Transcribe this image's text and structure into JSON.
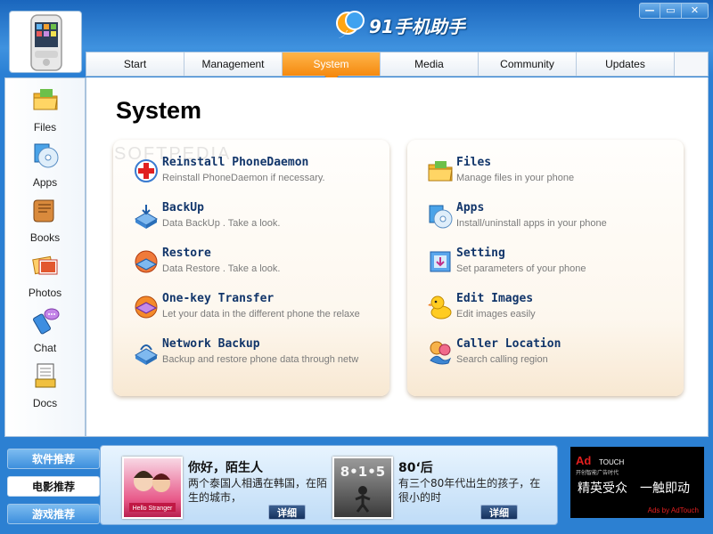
{
  "app": {
    "logo_text": "91手机助手",
    "window_controls": {
      "minimize": "—",
      "maximize": "▭",
      "close": "✕"
    }
  },
  "tabs": [
    {
      "label": "Start",
      "active": false
    },
    {
      "label": "Management",
      "active": false
    },
    {
      "label": "System",
      "active": true
    },
    {
      "label": "Media",
      "active": false
    },
    {
      "label": "Community",
      "active": false
    },
    {
      "label": "Updates",
      "active": false
    }
  ],
  "sidebar": {
    "items": [
      {
        "label": "Files",
        "icon": "folder-icon"
      },
      {
        "label": "Apps",
        "icon": "apps-cd-icon"
      },
      {
        "label": "Books",
        "icon": "scroll-icon"
      },
      {
        "label": "Photos",
        "icon": "photos-icon"
      },
      {
        "label": "Chat",
        "icon": "chat-phone-icon"
      },
      {
        "label": "Docs",
        "icon": "docs-icon"
      }
    ]
  },
  "main": {
    "title": "System",
    "watermark": "SOFTPEDIA",
    "left_items": [
      {
        "title": "Reinstall PhoneDaemon",
        "desc": "Reinstall PhoneDaemon if necessary.",
        "icon": "red-cross-icon"
      },
      {
        "title": "BackUp",
        "desc": "Data BackUp . Take a look.",
        "icon": "backup-disk-icon"
      },
      {
        "title": "Restore",
        "desc": "Data Restore . Take a look.",
        "icon": "restore-icon"
      },
      {
        "title": "One-key Transfer",
        "desc": "Let your data in the different phone the relaxe",
        "icon": "transfer-icon"
      },
      {
        "title": "Network Backup",
        "desc": "Backup and restore phone data through netw",
        "icon": "network-backup-icon"
      }
    ],
    "right_items": [
      {
        "title": "Files",
        "desc": "Manage files in your phone",
        "icon": "folder-icon"
      },
      {
        "title": "Apps",
        "desc": "Install/uninstall apps in your phone",
        "icon": "apps-cd-icon"
      },
      {
        "title": "Setting",
        "desc": "Set parameters of your phone",
        "icon": "settings-icon"
      },
      {
        "title": "Edit Images",
        "desc": "Edit images easily",
        "icon": "duck-icon"
      },
      {
        "title": "Caller Location",
        "desc": "Search calling region",
        "icon": "caller-icon"
      }
    ]
  },
  "bottom": {
    "tabs": [
      {
        "label": "软件推荐",
        "active": false
      },
      {
        "label": "电影推荐",
        "active": true
      },
      {
        "label": "游戏推荐",
        "active": false
      }
    ],
    "promos": [
      {
        "title": "你好，陌生人",
        "desc": "两个泰国人相遇在韩国，在陌生的城市，",
        "button": "详细",
        "poster_text": "Hello Stranger"
      },
      {
        "title": "80‘后",
        "desc": "有三个80年代出生的孩子，在很小的时",
        "button": "详细",
        "poster_text": "8•1•5"
      }
    ],
    "ad": {
      "brand": "Ad",
      "brand2": "TOUCH",
      "sub": "开创智能广告时代",
      "slogan": "精英受众　一触即动",
      "footer": "Ads by AdTouch"
    }
  }
}
